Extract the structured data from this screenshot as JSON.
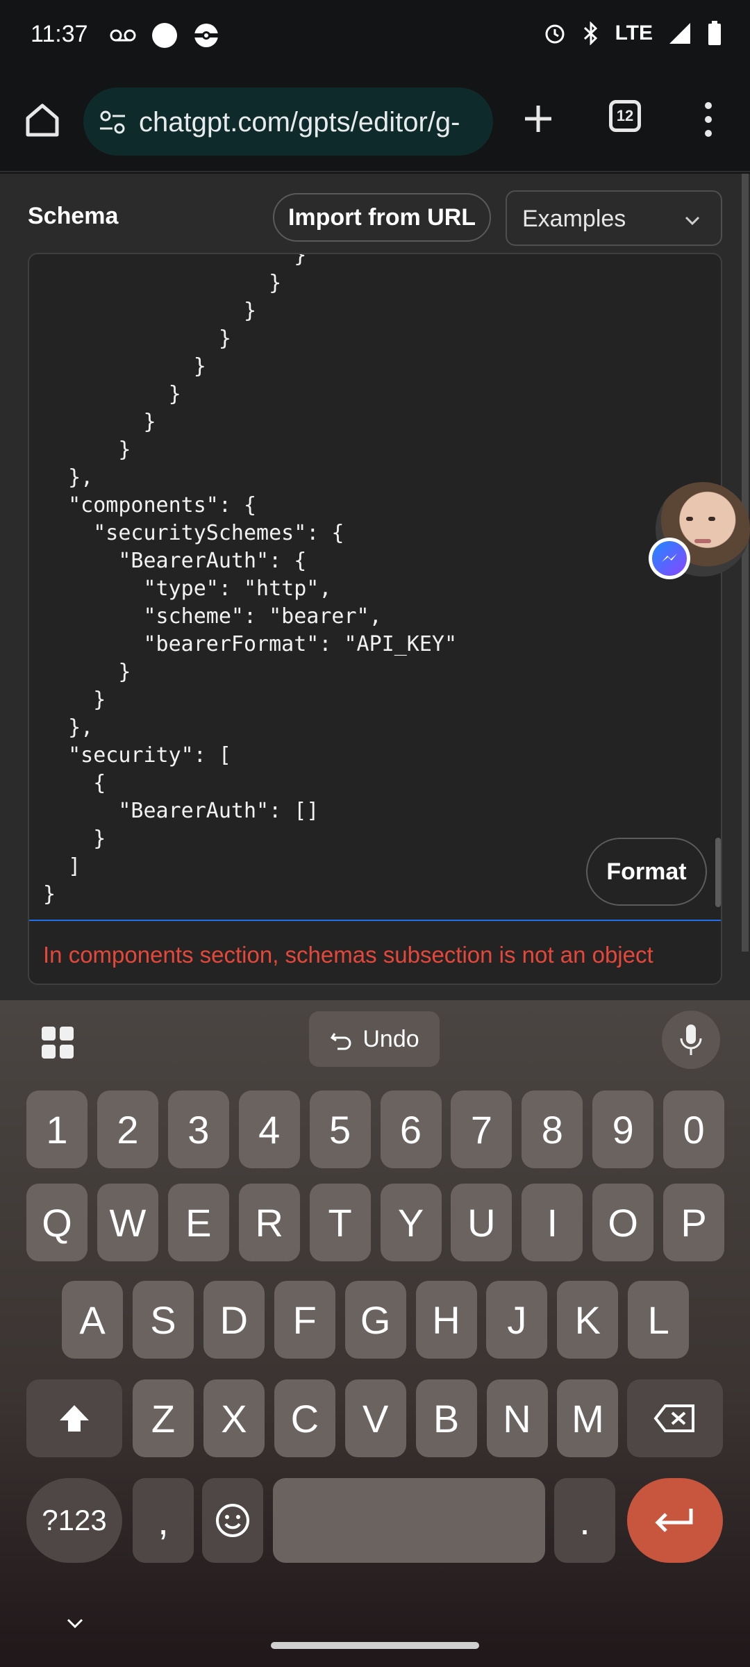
{
  "status_bar": {
    "time": "11:37",
    "network": "LTE"
  },
  "browser": {
    "url": "chatgpt.com/gpts/editor/g-",
    "tab_count": "12"
  },
  "editor": {
    "section_label": "Schema",
    "import_button": "Import from URL",
    "examples_select": "Examples",
    "format_button": "Format",
    "error_message": "In components section, schemas subsection is not an object",
    "code_lines": [
      "              }",
      "            }",
      "          }",
      "        }",
      "      }",
      "    }",
      "  }",
      "}",
      "},",
      "\"components\": {",
      "  \"securitySchemes\": {",
      "    \"BearerAuth\": {",
      "      \"type\": \"http\",",
      "      \"scheme\": \"bearer\",",
      "      \"bearerFormat\": \"API_KEY\"",
      "    }",
      "  }",
      "},",
      "\"security\": [",
      "  {",
      "    \"BearerAuth\": []",
      "  }",
      "]",
      "}"
    ]
  },
  "keyboard": {
    "undo_label": "Undo",
    "row_numbers": [
      "1",
      "2",
      "3",
      "4",
      "5",
      "6",
      "7",
      "8",
      "9",
      "0"
    ],
    "row_q": [
      "Q",
      "W",
      "E",
      "R",
      "T",
      "Y",
      "U",
      "I",
      "O",
      "P"
    ],
    "row_a": [
      "A",
      "S",
      "D",
      "F",
      "G",
      "H",
      "J",
      "K",
      "L"
    ],
    "row_z": [
      "Z",
      "X",
      "C",
      "V",
      "B",
      "N",
      "M"
    ],
    "symbols_key": "?123",
    "comma_key": ",",
    "period_key": "."
  }
}
